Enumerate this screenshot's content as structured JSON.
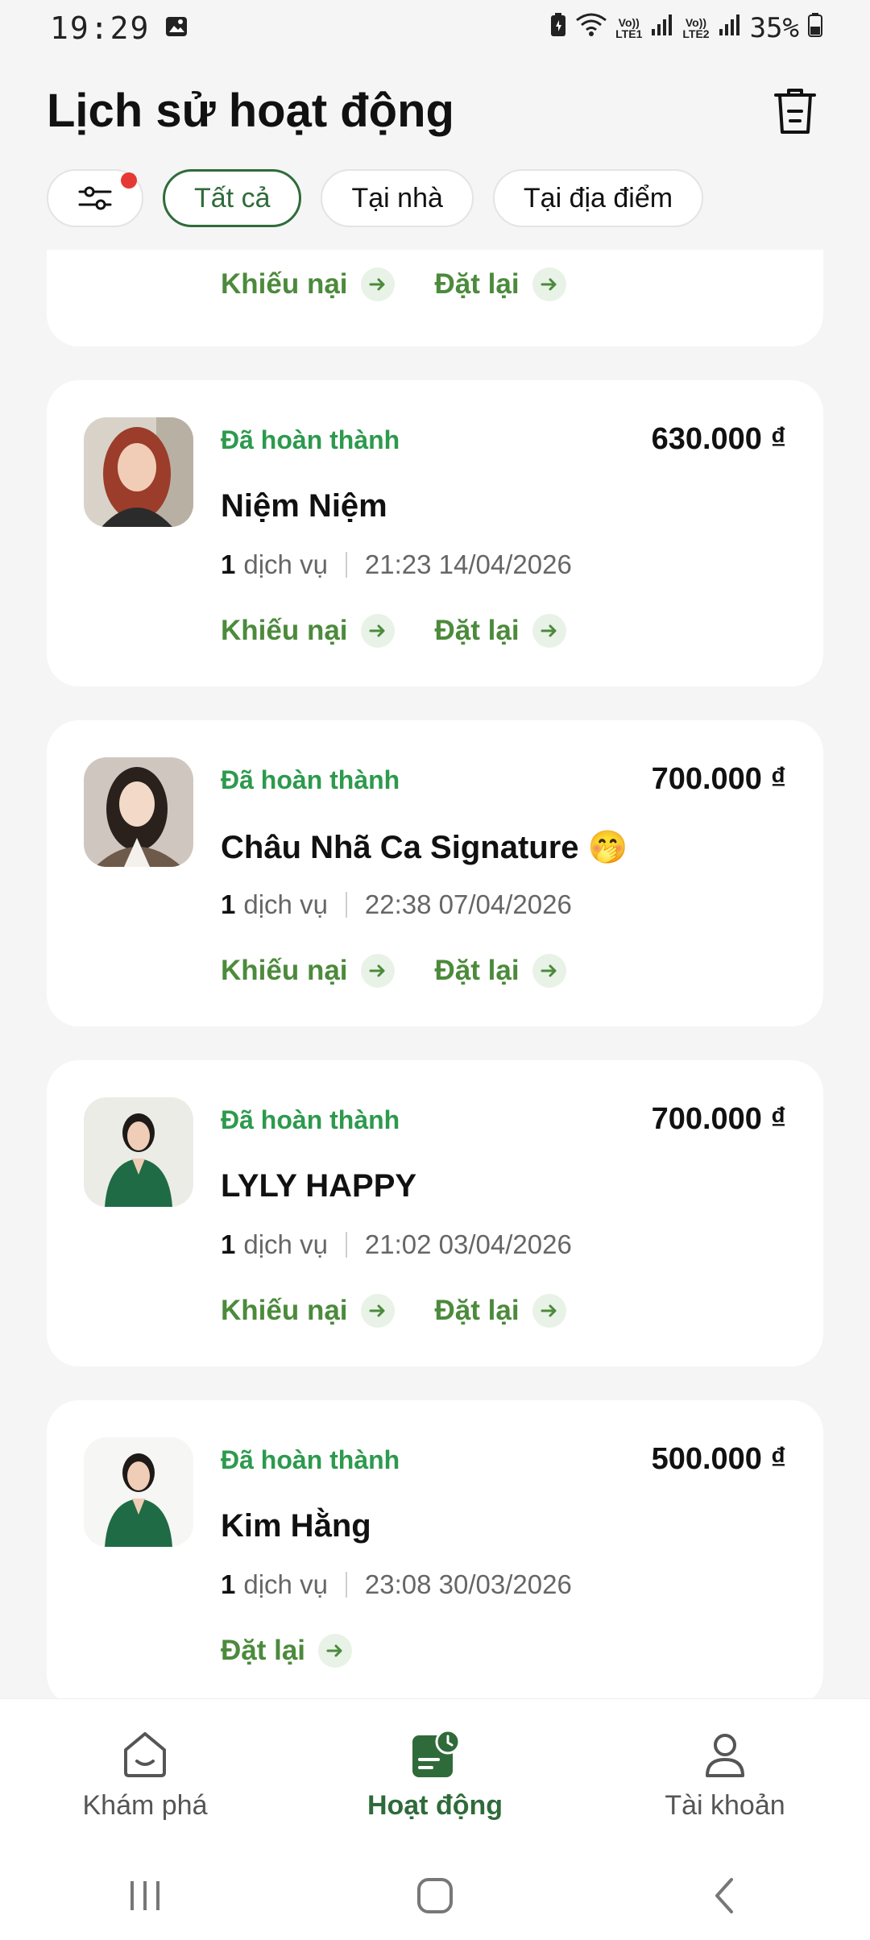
{
  "status_bar": {
    "time": "19:29",
    "battery": "35%",
    "sim1": "LTE1",
    "sim2": "LTE2",
    "volte": "Vo))"
  },
  "header": {
    "title": "Lịch sử hoạt động",
    "trash_icon": "trash-icon"
  },
  "filters": {
    "items": [
      {
        "label": "Tất cả",
        "active": true
      },
      {
        "label": "Tại nhà",
        "active": false
      },
      {
        "label": "Tại địa điểm",
        "active": false
      }
    ]
  },
  "action_labels": {
    "complain": "Khiếu nại",
    "reorder": "Đặt lại"
  },
  "bookings": [
    {
      "status": "Đã hoàn thành",
      "price": "630.000 ₫",
      "name": "Niệm Niệm",
      "service_count": "1",
      "service_unit": "dịch vụ",
      "datetime": "21:23 14/04/2026"
    },
    {
      "status": "Đã hoàn thành",
      "price": "700.000 ₫",
      "name": "Châu Nhã Ca Signature 🤭",
      "service_count": "1",
      "service_unit": "dịch vụ",
      "datetime": "22:38 07/04/2026"
    },
    {
      "status": "Đã hoàn thành",
      "price": "700.000 ₫",
      "name": "LYLY HAPPY",
      "service_count": "1",
      "service_unit": "dịch vụ",
      "datetime": "21:02 03/04/2026"
    },
    {
      "status": "Đã hoàn thành",
      "price": "500.000 ₫",
      "name": "Kim Hằng",
      "service_count": "1",
      "service_unit": "dịch vụ",
      "datetime": "23:08 30/03/2026"
    }
  ],
  "bottom_nav": {
    "items": [
      {
        "label": "Khám phá",
        "icon": "home-icon"
      },
      {
        "label": "Hoạt động",
        "icon": "activity-icon",
        "active": true
      },
      {
        "label": "Tài khoản",
        "icon": "account-icon"
      }
    ]
  },
  "colors": {
    "brand_green": "#2f6b3a",
    "status_green": "#2d9a4e",
    "action_green": "#4c8a3c",
    "notification_red": "#e53935"
  }
}
